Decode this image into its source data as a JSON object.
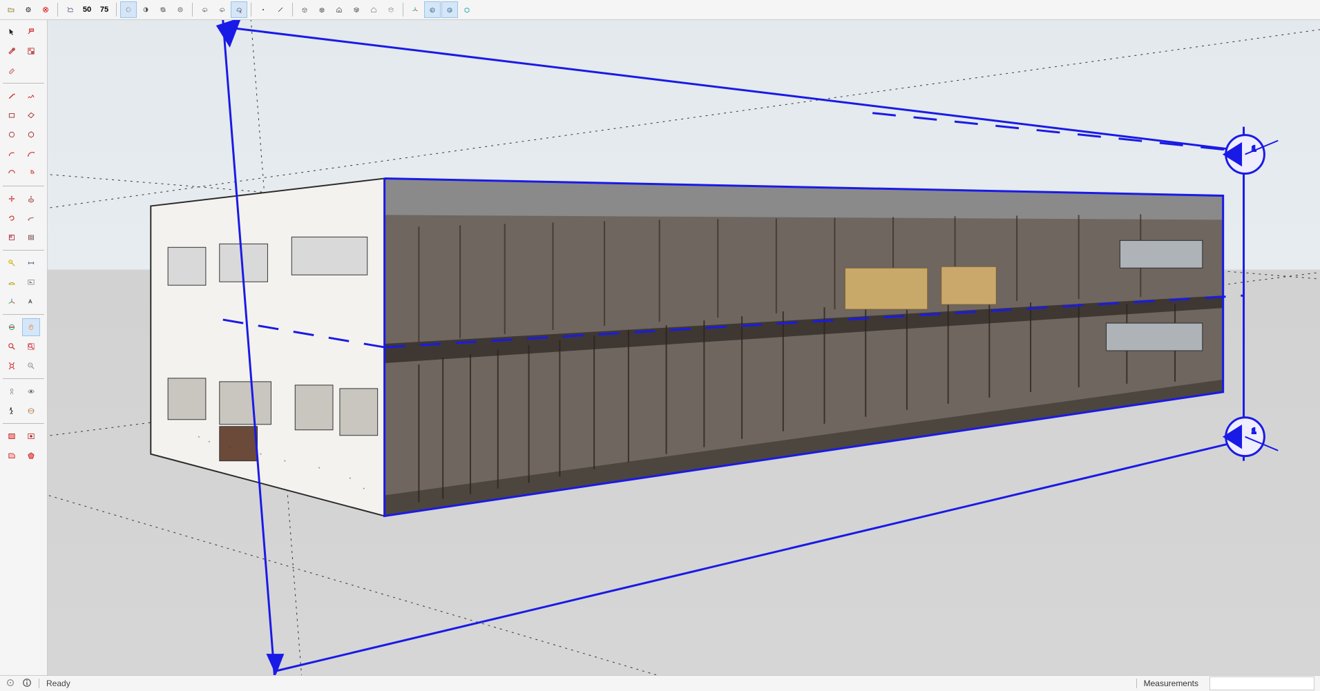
{
  "top_toolbar": {
    "groups": [
      [
        {
          "name": "open-icon",
          "title": "Open"
        },
        {
          "name": "settings-icon",
          "title": "Settings"
        },
        {
          "name": "close-red-icon",
          "title": "Close"
        }
      ],
      [
        {
          "name": "cloud-tag-icon",
          "title": "Tag"
        },
        {
          "name": "density-50-icon",
          "title": "50",
          "text": "50"
        },
        {
          "name": "density-75-icon",
          "title": "75",
          "text": "75"
        }
      ],
      [
        {
          "name": "shading-simple-icon",
          "title": "Shaded",
          "active": true
        },
        {
          "name": "shading-half-icon",
          "title": "Shaded Textures"
        },
        {
          "name": "shading-hatched-icon",
          "title": "Hidden Line"
        },
        {
          "name": "shading-lines-icon",
          "title": "Wireframe"
        }
      ],
      [
        {
          "name": "cloud-down-icon",
          "title": "Cloud Down"
        },
        {
          "name": "cloud-up-icon",
          "title": "Cloud Up"
        },
        {
          "name": "cloud-person-icon",
          "title": "Cloud User",
          "active": true
        }
      ],
      [
        {
          "name": "point-icon",
          "title": "Point"
        },
        {
          "name": "line-icon",
          "title": "Line"
        }
      ],
      [
        {
          "name": "box-wire-icon",
          "title": "Box"
        },
        {
          "name": "box-solid-icon",
          "title": "Solid"
        },
        {
          "name": "house-icon",
          "title": "Home"
        },
        {
          "name": "box-open-icon",
          "title": "Open Box"
        },
        {
          "name": "house-outline-icon",
          "title": "Outline Home"
        },
        {
          "name": "box-open2-icon",
          "title": "Open Box 2"
        }
      ],
      [
        {
          "name": "axis-icon",
          "title": "Axes"
        },
        {
          "name": "cube-left-icon",
          "title": "View L",
          "active": true
        },
        {
          "name": "cube-right-icon",
          "title": "View R",
          "active": true
        },
        {
          "name": "cube-teal-icon",
          "title": "View Iso"
        }
      ]
    ]
  },
  "left_toolbar_rows": [
    [
      {
        "n": "select-arrow-icon",
        "t": "Select"
      },
      {
        "n": "tape-red-icon",
        "t": "Tape"
      }
    ],
    [
      {
        "n": "paint-icon",
        "t": "Paint"
      },
      {
        "n": "swatch-icon",
        "t": "Material"
      }
    ],
    [
      {
        "n": "eraser-icon",
        "t": "Eraser"
      },
      {
        "n": "blank",
        "t": ""
      }
    ],
    "sep",
    [
      {
        "n": "pencil-icon",
        "t": "Line"
      },
      {
        "n": "freehand-icon",
        "t": "Freehand"
      }
    ],
    [
      {
        "n": "rect-icon",
        "t": "Rectangle"
      },
      {
        "n": "rect-rot-icon",
        "t": "Rotated Rect"
      }
    ],
    [
      {
        "n": "circle-icon",
        "t": "Circle"
      },
      {
        "n": "polygon-icon",
        "t": "Polygon"
      }
    ],
    [
      {
        "n": "arc-icon",
        "t": "Arc"
      },
      {
        "n": "arc2-icon",
        "t": "2pt Arc"
      }
    ],
    [
      {
        "n": "arc3-icon",
        "t": "3pt Arc"
      },
      {
        "n": "pie-icon",
        "t": "Pie"
      }
    ],
    "sep",
    [
      {
        "n": "move-icon",
        "t": "Move"
      },
      {
        "n": "pushpull-icon",
        "t": "PushPull"
      }
    ],
    [
      {
        "n": "rotate-icon",
        "t": "Rotate"
      },
      {
        "n": "followme-icon",
        "t": "FollowMe"
      }
    ],
    [
      {
        "n": "scale-icon",
        "t": "Scale"
      },
      {
        "n": "offset-icon",
        "t": "Offset"
      }
    ],
    "sep",
    [
      {
        "n": "tape-measure-icon",
        "t": "TapeMeasure"
      },
      {
        "n": "dimension-icon",
        "t": "Dimension"
      }
    ],
    [
      {
        "n": "protractor-icon",
        "t": "Protractor"
      },
      {
        "n": "text-icon",
        "t": "Text"
      }
    ],
    [
      {
        "n": "axes-tool-icon",
        "t": "Axes"
      },
      {
        "n": "3dtext-icon",
        "t": "3DText"
      }
    ],
    "sep",
    [
      {
        "n": "orbit-icon",
        "t": "Orbit"
      },
      {
        "n": "pan-icon",
        "t": "Pan",
        "active": true
      }
    ],
    [
      {
        "n": "zoom-icon",
        "t": "Zoom"
      },
      {
        "n": "zoom-window-icon",
        "t": "ZoomWindow"
      }
    ],
    [
      {
        "n": "zoom-extents-icon",
        "t": "ZoomExtents"
      },
      {
        "n": "previous-icon",
        "t": "Previous"
      }
    ],
    "sep",
    [
      {
        "n": "position-camera-icon",
        "t": "PositionCam"
      },
      {
        "n": "look-around-icon",
        "t": "LookAround"
      }
    ],
    [
      {
        "n": "walk-icon",
        "t": "Walk"
      },
      {
        "n": "section-icon",
        "t": "Section"
      }
    ],
    "sep",
    [
      {
        "n": "extension1-icon",
        "t": "Ext1"
      },
      {
        "n": "extension2-icon",
        "t": "Ext2"
      }
    ],
    [
      {
        "n": "extension3-icon",
        "t": "Ext3"
      },
      {
        "n": "extension4-icon",
        "t": "Ext4"
      }
    ]
  ],
  "section_planes": {
    "plane_1_label": "1",
    "plane_2_label": "1"
  },
  "status": {
    "ready": "Ready",
    "measurements_label": "Measurements",
    "measurements_value": ""
  },
  "colors": {
    "section_blue": "#1a1ae6",
    "axis_gray": "#555"
  }
}
